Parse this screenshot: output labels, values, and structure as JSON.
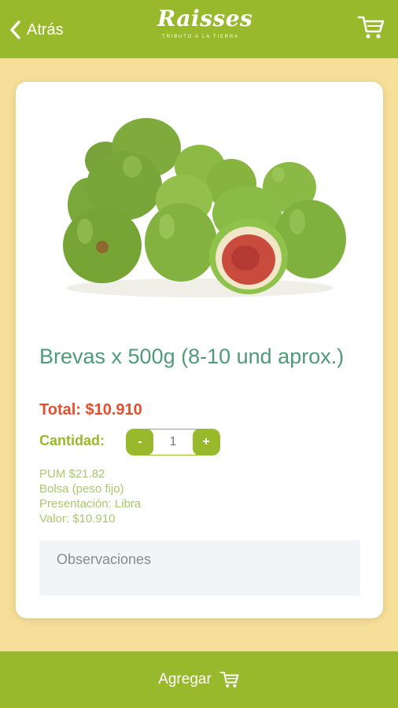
{
  "header": {
    "back_label": "Atrás",
    "logo_text": "Raisses",
    "logo_tagline": "TRIBUTO A LA TIERRA"
  },
  "colors": {
    "brand_green": "#97b92b",
    "background_yellow": "#f6df98",
    "title_teal": "#4f9a78",
    "total_red": "#e4502d"
  },
  "product": {
    "title": "Brevas x 500g (8-10 und aprox.)",
    "total": "Total: $10.910",
    "quantity_label": "Cantidad:",
    "quantity": "1",
    "decrement_label": "-",
    "increment_label": "+",
    "details": [
      "PUM $21.82",
      "Bolsa (peso fijo)",
      "Presentación: Libra",
      "Valor: $10.910"
    ],
    "observations_placeholder": "Observaciones"
  },
  "footer": {
    "add_label": "Agregar"
  },
  "icons": {
    "back": "chevron-left-icon",
    "cart": "cart-icon",
    "add": "cart-icon"
  }
}
